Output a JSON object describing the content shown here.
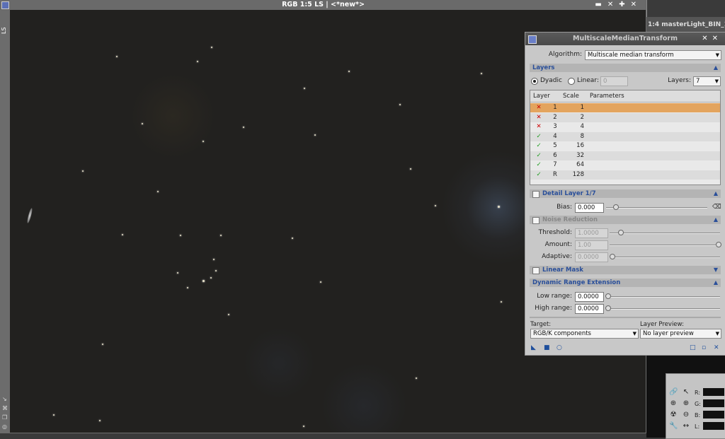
{
  "image_window": {
    "title": "RGB 1:5 LS | <*new*>",
    "controls": [
      "▬",
      "✕",
      "✚",
      "✕"
    ],
    "side_tab_label": "LS"
  },
  "behind_window": {
    "title": "1:4 masterLight_BIN_1"
  },
  "dialog": {
    "title": "MultiscaleMedianTransform",
    "algorithm_label": "Algorithm:",
    "algorithm_value": "Multiscale median transform",
    "layers_section": "Layers",
    "dyadic_label": "Dyadic",
    "linear_label": "Linear:",
    "linear_value": "0",
    "layers_label": "Layers:",
    "layers_value": "7",
    "table": {
      "headers": [
        "Layer",
        "Scale",
        "Parameters"
      ],
      "rows": [
        {
          "mark": "✕",
          "layer": "1",
          "scale": "1",
          "enabled": false,
          "selected": true
        },
        {
          "mark": "✕",
          "layer": "2",
          "scale": "2",
          "enabled": false,
          "selected": false
        },
        {
          "mark": "✕",
          "layer": "3",
          "scale": "4",
          "enabled": false,
          "selected": false
        },
        {
          "mark": "✓",
          "layer": "4",
          "scale": "8",
          "enabled": true,
          "selected": false
        },
        {
          "mark": "✓",
          "layer": "5",
          "scale": "16",
          "enabled": true,
          "selected": false
        },
        {
          "mark": "✓",
          "layer": "6",
          "scale": "32",
          "enabled": true,
          "selected": false
        },
        {
          "mark": "✓",
          "layer": "7",
          "scale": "64",
          "enabled": true,
          "selected": false
        },
        {
          "mark": "✓",
          "layer": "R",
          "scale": "128",
          "enabled": true,
          "selected": false
        }
      ]
    },
    "detail_section": "Detail Layer 1/7",
    "bias_label": "Bias:",
    "bias_value": "0.000",
    "noise_section": "Noise Reduction",
    "threshold_label": "Threshold:",
    "threshold_value": "1.0000",
    "amount_label": "Amount:",
    "amount_value": "1.00",
    "adaptive_label": "Adaptive:",
    "adaptive_value": "0.0000",
    "linear_mask_section": "Linear Mask",
    "dre_section": "Dynamic Range Extension",
    "low_range_label": "Low range:",
    "low_range_value": "0.0000",
    "high_range_label": "High range:",
    "high_range_value": "0.0000",
    "target_label": "Target:",
    "target_value": "RGB/K components",
    "layer_preview_label": "Layer Preview:",
    "layer_preview_value": "No layer preview"
  },
  "readout": {
    "labels": [
      "R:",
      "G:",
      "B:",
      "L:"
    ]
  },
  "colors": {
    "accent_blue": "#2a4f9a",
    "selected_row": "#e3a45e",
    "disabled_mark": "#cc0000",
    "enabled_mark": "#1a9a1a"
  }
}
